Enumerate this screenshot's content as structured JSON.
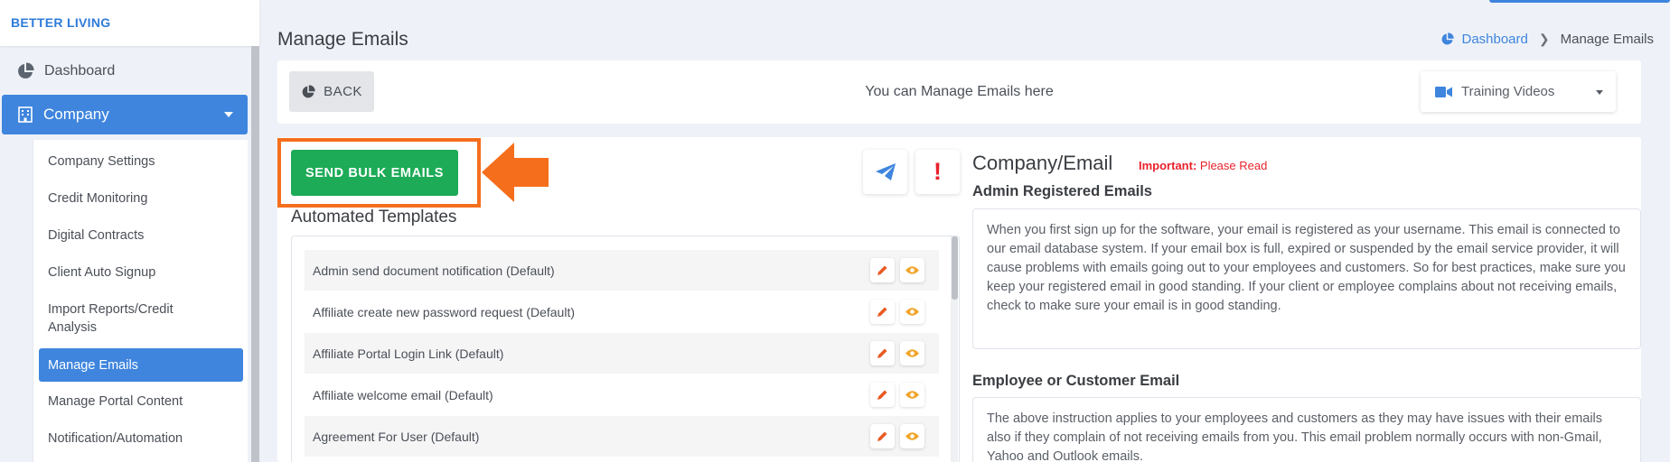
{
  "app": {
    "brand": "BETTER LIVING"
  },
  "sidebar": {
    "dashboard_label": "Dashboard",
    "company_label": "Company",
    "submenu": [
      {
        "label": "Company Settings"
      },
      {
        "label": "Credit Monitoring"
      },
      {
        "label": "Digital Contracts"
      },
      {
        "label": "Client Auto Signup"
      },
      {
        "label": "Import Reports/Credit Analysis"
      },
      {
        "label": "Manage Emails",
        "active": true
      },
      {
        "label": "Manage Portal Content"
      },
      {
        "label": "Notification/Automation"
      }
    ]
  },
  "header": {
    "title": "Manage Emails",
    "breadcrumb": {
      "home": "Dashboard",
      "current": "Manage Emails"
    }
  },
  "toolbar": {
    "back_label": "BACK",
    "message": "You can Manage Emails here",
    "training_label": "Training Videos"
  },
  "left": {
    "bulk_button": "SEND BULK EMAILS",
    "templates_title": "Automated Templates",
    "templates": [
      {
        "name": "Admin send document notification (Default)"
      },
      {
        "name": "Affiliate create new password request (Default)"
      },
      {
        "name": "Affiliate Portal Login Link (Default)"
      },
      {
        "name": "Affiliate welcome email (Default)"
      },
      {
        "name": "Agreement For User (Default)"
      }
    ]
  },
  "right": {
    "title": "Company/Email",
    "important_label": "Important:",
    "important_text": " Please Read",
    "admin_title": "Admin Registered Emails",
    "admin_text": "When you first sign up for the software, your email is registered as your username. This email is connected to our email database system. If your email box is full, expired or suspended by the email service provider, it will cause problems with emails going out to your employees and customers. So for best practices, make sure you keep your registered email in good standing. If your client or employee complains about not receiving emails, check to make sure your email is in good standing.",
    "employee_title": "Employee or Customer Email",
    "employee_text": "The above instruction applies to your employees and customers as they may have issues with their emails also if they complain of not receiving emails from you. This email problem normally occurs with non-Gmail, Yahoo and Outlook emails."
  },
  "colors": {
    "primary": "#3f85de",
    "success": "#1dab57",
    "highlight": "#f56e1c",
    "danger": "#e8222c"
  }
}
